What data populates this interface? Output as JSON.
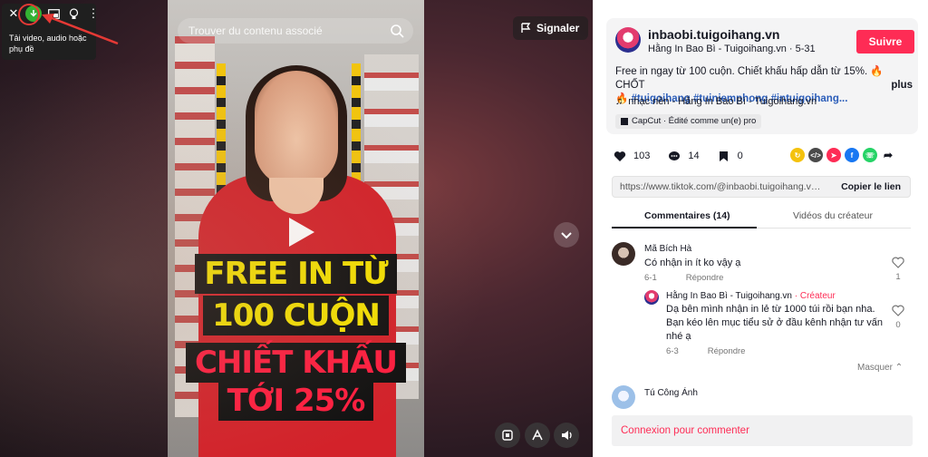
{
  "extension": {
    "tooltip": "Tải video, audio hoặc phụ đề",
    "icons": [
      "close-icon",
      "download-icon",
      "picture-in-picture-icon",
      "lightbulb-icon",
      "more-vertical-icon"
    ]
  },
  "video": {
    "search_placeholder": "Trouver du contenu associé",
    "report_label": "Signaler",
    "overlay": {
      "line1": "FREE IN TỪ",
      "line2": "100 CUỘN",
      "line3": "CHIẾT KHẤU",
      "line4": "TỚI 25%"
    },
    "colors": {
      "overlay_yellow": "#f5e200",
      "overlay_red": "#ff1d3f"
    }
  },
  "post": {
    "username": "inbaobi.tuigoihang.vn",
    "author_line": "Hằng In Bao Bì - Tuigoihang.vn · 5-31",
    "follow_label": "Suivre",
    "description_text": "Free in ngay từ 100 cuộn. Chiết khấu hấp dẫn từ 15%. 🔥 CHỐT",
    "description_tags": "🔥 #tuigoihang #tuiniemphong #intuigoihang...",
    "description_more": "plus",
    "music": "nhạc nền - Hằng In Bao Bì - Tuigoihang.vn",
    "capcut": "CapCut · Édité comme un(e) pro",
    "likes": "103",
    "comments": "14",
    "saves": "0",
    "link_url": "https://www.tiktok.com/@inbaobi.tuigoihang.vn/vi...",
    "copy_label": "Copier le lien",
    "accent_color": "#fe2c55"
  },
  "tabs": {
    "comments": "Commentaires (14)",
    "creator_videos": "Vidéos du créateur"
  },
  "comments": [
    {
      "name": "Mã Bích Hà",
      "text": "Có nhận in ít ko vậy ạ",
      "date": "6-1",
      "reply_label": "Répondre",
      "likes": "1"
    },
    {
      "name": "Hằng In Bao Bì - Tuigoihang.vn",
      "badge": "· Créateur",
      "text": "Dạ bên mình nhận in lẻ từ 1000 túi rồi bạn nha. Bạn kéo lên mục tiểu sử ở đầu kênh nhận tư vấn nhé ạ",
      "date": "6-3",
      "reply_label": "Répondre",
      "likes": "0"
    },
    {
      "name": "Tú Công Ánh"
    }
  ],
  "hide_label": "Masquer",
  "login_prompt": "Connexion pour commenter"
}
